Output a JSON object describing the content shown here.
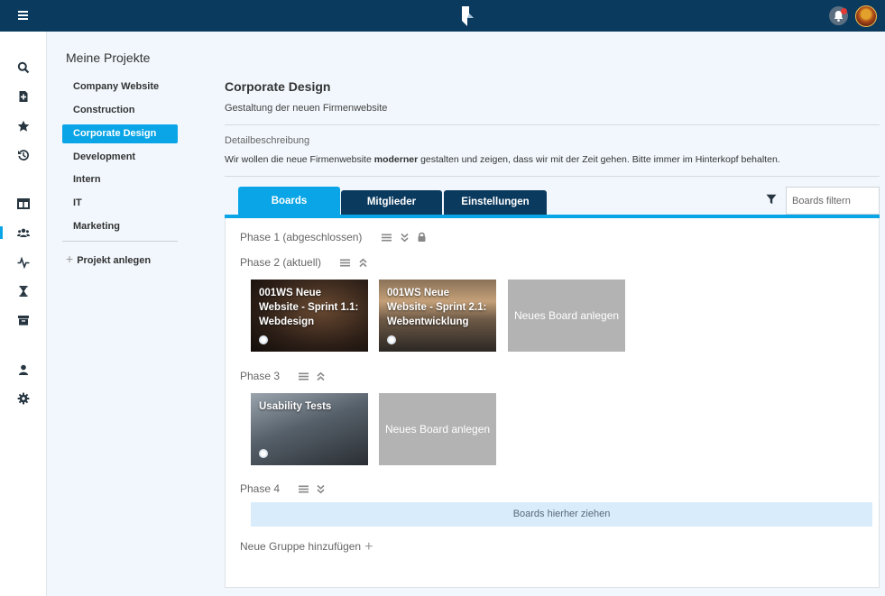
{
  "sidebar": {
    "title": "Meine Projekte",
    "projects": [
      "Company Website",
      "Construction",
      "Corporate Design",
      "Development",
      "Intern",
      "IT",
      "Marketing"
    ],
    "active_project": "Corporate Design",
    "add_label": "Projekt anlegen"
  },
  "rail_icons": [
    "search-icon",
    "add-document-icon",
    "star-icon",
    "history-icon",
    "board-icon",
    "team-icon",
    "activity-icon",
    "hourglass-icon",
    "archive-icon",
    "user-icon",
    "settings-icon"
  ],
  "project": {
    "title": "Corporate Design",
    "subtitle": "Gestaltung der neuen Firmenwebsite",
    "detail_label": "Detailbeschreibung",
    "detail_before": "Wir wollen die neue Firmenwebsite ",
    "detail_bold": "moderner",
    "detail_after": " gestalten und zeigen, dass wir mit der Zeit gehen. Bitte immer im Hinterkopf behalten."
  },
  "tabs": [
    "Boards",
    "Mitglieder",
    "Einstellungen"
  ],
  "active_tab": "Boards",
  "filter": {
    "placeholder": "Boards filtern"
  },
  "phases": [
    {
      "title": "Phase 1 (abgeschlossen)",
      "collapsed": true,
      "locked": true
    },
    {
      "title": "Phase 2 (aktuell)",
      "boards": [
        {
          "title": "001WS Neue Website - Sprint 1.1: Webdesign"
        },
        {
          "title": "001WS Neue Website - Sprint 2.1: Webentwicklung"
        }
      ],
      "new_board_label": "Neues Board anlegen"
    },
    {
      "title": "Phase 3",
      "boards": [
        {
          "title": "Usability Tests"
        }
      ],
      "new_board_label": "Neues Board anlegen"
    },
    {
      "title": "Phase 4",
      "dropzone_label": "Boards hierher ziehen"
    }
  ],
  "add_group_label": "Neue Gruppe hinzufügen",
  "colors": {
    "topbar": "#0b3a5f",
    "accent": "#0aa5e6",
    "tab_inactive": "#0b3a5f",
    "new_board": "#b3b3b3"
  }
}
